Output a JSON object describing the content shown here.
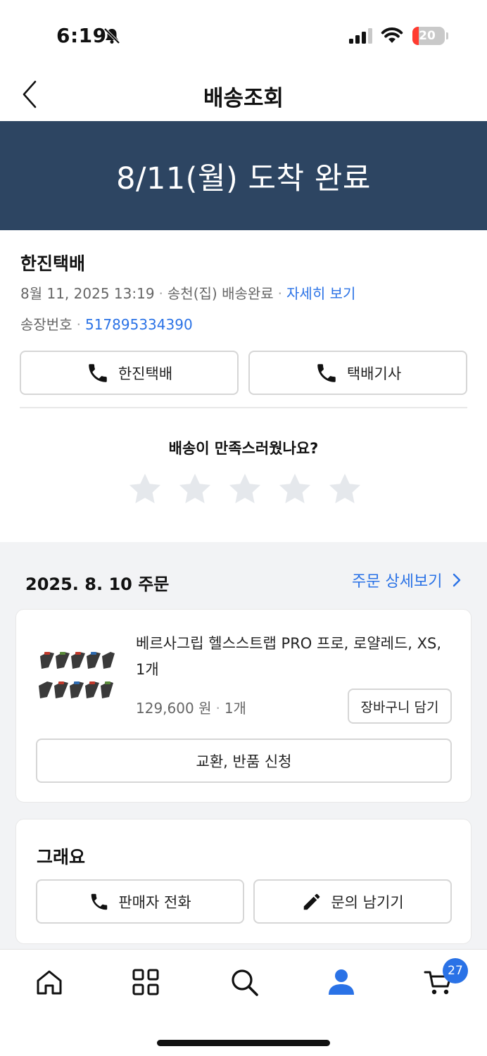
{
  "status_bar": {
    "time": "6:19",
    "battery": "20",
    "battery_level": 0.2
  },
  "header": {
    "title": "배송조회"
  },
  "banner": {
    "text": "8/11(월) 도착 완료",
    "color": "#2d4562"
  },
  "carrier": {
    "name": "한진택배",
    "datetime": "8월 11, 2025 13:19",
    "location_status": "송천(집) 배송완료",
    "detail_link": "자세히 보기",
    "invoice_label": "송장번호",
    "invoice_number": "517895334390",
    "call_carrier_label": "한진택배",
    "call_driver_label": "택배기사"
  },
  "satisfaction": {
    "question": "배송이 만족스러웠나요?",
    "rating": 0,
    "max": 5
  },
  "order": {
    "date": "2025. 8. 10 주문",
    "detail_link": "주문 상세보기",
    "product": {
      "name": "베르사그립 헬스스트랩 PRO 프로, 로얄레드, XS, 1개",
      "price": "129,600 원",
      "quantity": "1개",
      "cart_button": "장바구니 담기",
      "return_button": "교환, 반품 신청"
    }
  },
  "seller": {
    "name": "그래요",
    "call_button": "판매자 전화",
    "inquiry_button": "문의 남기기"
  },
  "tab_bar": {
    "items": [
      "home-icon",
      "grid-icon",
      "search-icon",
      "profile-icon",
      "cart-icon"
    ],
    "active": "profile-icon",
    "cart_count": "27",
    "accent": "#2a72e6"
  }
}
